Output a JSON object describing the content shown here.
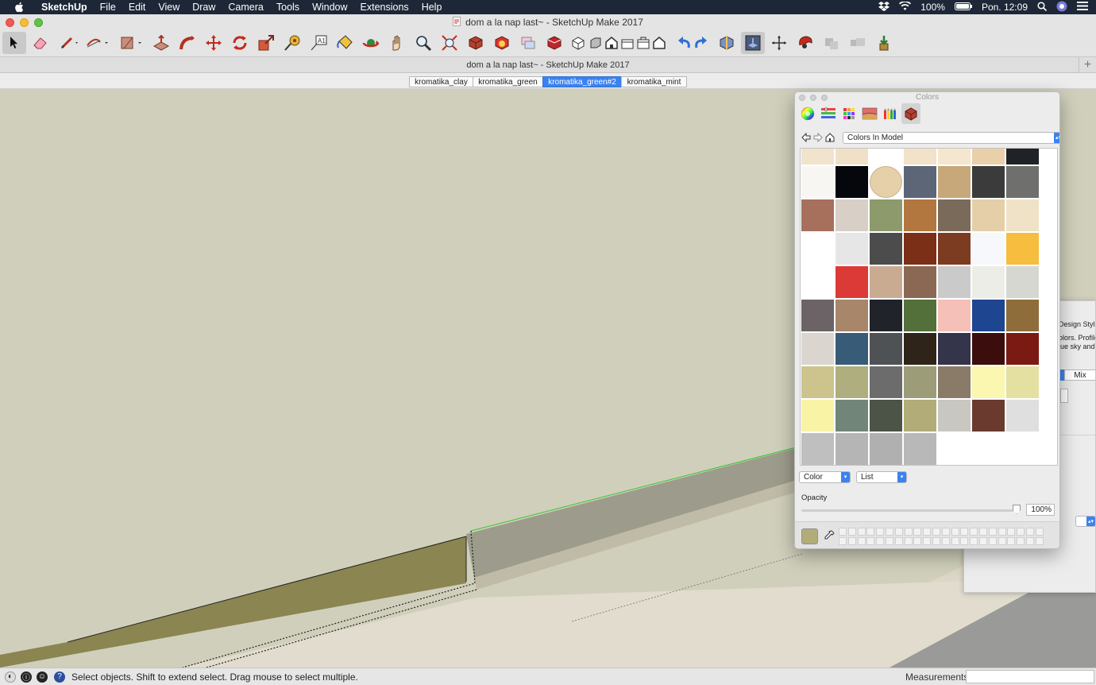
{
  "menubar": {
    "app_name": "SketchUp",
    "items": [
      "File",
      "Edit",
      "View",
      "Draw",
      "Camera",
      "Tools",
      "Window",
      "Extensions",
      "Help"
    ],
    "battery": "100%",
    "clock": "Pon. 12:09"
  },
  "window": {
    "title": "dom a la nap last~ - SketchUp Make 2017",
    "doc_title": "dom a la nap last~ - SketchUp Make 2017"
  },
  "toolbar": {
    "tools": [
      "select",
      "eraser",
      "line",
      "arc",
      "rectangle",
      "push-pull",
      "follow-me",
      "move",
      "rotate",
      "scale",
      "tape-measure",
      "text",
      "paint-bucket",
      "orbit",
      "pan",
      "zoom",
      "zoom-extents",
      "components",
      "styles",
      "layers",
      "3d-warehouse",
      "iso",
      "top",
      "front",
      "right",
      "back",
      "left",
      "undo",
      "redo",
      "section",
      "xray",
      "axes",
      "styles-panel",
      "ext1",
      "ext2",
      "download"
    ]
  },
  "scenes": {
    "tabs": [
      {
        "label": "kromatika_clay",
        "active": false
      },
      {
        "label": "kromatika_green",
        "active": false
      },
      {
        "label": "kromatika_green#2",
        "active": true
      },
      {
        "label": "kromatika_mint",
        "active": false
      }
    ]
  },
  "colors_window": {
    "title": "Colors",
    "palette": "Colors In Model",
    "mode_select": "Color",
    "view_select": "List",
    "opacity_label": "Opacity",
    "opacity_value": "100%",
    "opacity_fraction": 1.0,
    "current_color": "#b2ac78",
    "swatches": [
      [
        "#f8f6f2",
        "#06070c",
        "#e6d0aa",
        "#5d6677",
        "#c7a87a",
        "#3b3b3b",
        "#6f6f6d"
      ],
      [
        "#a6705d",
        "#d8cfc6",
        "#8c9a6c",
        "#b2773f",
        "#7a6a5a",
        "#e4cfa8",
        "#efe2c6"
      ],
      [
        "#ffffff",
        "#e6e6e6",
        "#4c4c4c",
        "#7b2f17",
        "#7c3c22",
        "#f7f8fc",
        "#f6bd3f"
      ],
      [
        "#ffffff",
        "#dc3a37",
        "#c9ab92",
        "#8a6853",
        "#cacaca",
        "#edede8",
        "#d7d7d2"
      ],
      [
        "#6b6365",
        "#a8866a",
        "#21232a",
        "#536f3a",
        "#f4c0b7",
        "#1e4690",
        "#8f6d3a"
      ],
      [
        "#dad5cf",
        "#385c77",
        "#4f5255",
        "#2f2419",
        "#34344a",
        "#3c0d0d",
        "#7b1a13"
      ],
      [
        "#ccc48c",
        "#aeae7e",
        "#6c6c6c",
        "#9c9c78",
        "#8a7b68",
        "#fbf6b0",
        "#e4e0a2"
      ],
      [
        "#f9f3a6",
        "#728579",
        "#4c5347",
        "#b2ac78",
        "#c9c7c2",
        "#6a3a2e",
        "#dfdfdf"
      ],
      [
        "#bfbfbf",
        "#b5b5b5",
        "#b0b0b0",
        "#b8b8b8",
        "",
        "",
        ""
      ]
    ],
    "top_row_partial": [
      "#f1e3cc",
      "#f0e0c8",
      "#ffffff",
      "#f2e2c9",
      "#f4e6cf",
      "#e9cfaa",
      "#1f2226"
    ]
  },
  "styles_panel": {
    "heading": "Design Style",
    "desc_line1": "olors. Profile",
    "desc_line2": "lue sky and",
    "tab": "Mix"
  },
  "statusbar": {
    "hint": "Select objects. Shift to extend select. Drag mouse to select multiple.",
    "measurements_label": "Measurements",
    "measurements_value": ""
  }
}
